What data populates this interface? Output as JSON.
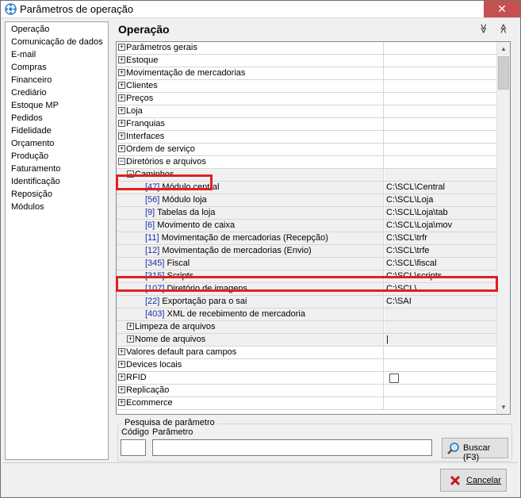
{
  "window": {
    "title": "Parâmetros de operação",
    "close_glyph": "✕"
  },
  "sidebar": {
    "items": [
      {
        "label": "Operação"
      },
      {
        "label": "Comunicação de dados"
      },
      {
        "label": "E-mail"
      },
      {
        "label": "Compras"
      },
      {
        "label": "Financeiro"
      },
      {
        "label": "Crediário"
      },
      {
        "label": "Estoque MP"
      },
      {
        "label": "Pedidos"
      },
      {
        "label": "Fidelidade"
      },
      {
        "label": "Orçamento"
      },
      {
        "label": "Produção"
      },
      {
        "label": "Faturamento"
      },
      {
        "label": "Identificação"
      },
      {
        "label": "Reposição"
      },
      {
        "label": "Módulos"
      }
    ]
  },
  "main": {
    "title": "Operação",
    "collapse_all_glyph": "≫",
    "expand_all_glyph": "≪"
  },
  "grid": {
    "rows": [
      {
        "expander": "+",
        "name": "Parâmetros gerais",
        "value": ""
      },
      {
        "expander": "+",
        "name": "Estoque",
        "value": ""
      },
      {
        "expander": "+",
        "name": "Movimentação de mercadorias",
        "value": ""
      },
      {
        "expander": "+",
        "name": "Clientes",
        "value": ""
      },
      {
        "expander": "+",
        "name": "Preços",
        "value": ""
      },
      {
        "expander": "+",
        "name": "Loja",
        "value": ""
      },
      {
        "expander": "+",
        "name": "Franquias",
        "value": ""
      },
      {
        "expander": "+",
        "name": "Interfaces",
        "value": ""
      },
      {
        "expander": "+",
        "name": "Ordem de serviço",
        "value": ""
      },
      {
        "expander": "−",
        "name": "Diretórios e arquivos",
        "value": ""
      },
      {
        "expander": "−",
        "name": "Caminhos",
        "value": ""
      },
      {
        "code": "[47]",
        "name": "Módulo central",
        "value": "C:\\SCL\\Central"
      },
      {
        "code": "[56]",
        "name": "Módulo loja",
        "value": "C:\\SCL\\Loja"
      },
      {
        "code": "[9]",
        "name": "Tabelas da loja",
        "value": "C:\\SCL\\Loja\\tab"
      },
      {
        "code": "[6]",
        "name": "Movimento de caixa",
        "value": "C:\\SCL\\Loja\\mov"
      },
      {
        "code": "[11]",
        "name": "Movimentação de mercadorias (Recepção)",
        "value": "C:\\SCL\\trfr"
      },
      {
        "code": "[12]",
        "name": "Movimentação de mercadorias (Envio)",
        "value": "C:\\SCL\\trfe"
      },
      {
        "code": "[345]",
        "name": "Fiscal",
        "value": "C:\\SCL\\fiscal"
      },
      {
        "code": "[315]",
        "name": "Scripts",
        "value": "C:\\SCL\\scripts"
      },
      {
        "code": "[107]",
        "name": "Diretório de imagens",
        "value": "C:\\SCL\\"
      },
      {
        "code": "[22]",
        "name": "Exportação para o sai",
        "value": "C:\\SAI"
      },
      {
        "code": "[403]",
        "name": "XML de recebimento de mercadoria",
        "value": ""
      },
      {
        "expander": "+",
        "name": "Limpeza de arquivos",
        "value": ""
      },
      {
        "expander": "+",
        "name": "Nome de arquivos",
        "value": "|"
      },
      {
        "expander": "+",
        "name": "Valores default para campos",
        "value": ""
      },
      {
        "expander": "+",
        "name": "Devices locais",
        "value": ""
      },
      {
        "expander": "+",
        "name": "RFID",
        "value": ""
      },
      {
        "expander": "+",
        "name": "Replicação",
        "value": ""
      },
      {
        "expander": "+",
        "name": "Ecommerce",
        "value": ""
      }
    ],
    "scroll_up_glyph": "▲",
    "scroll_down_glyph": "▼"
  },
  "search": {
    "legend": "Pesquisa de parâmetro",
    "code_label": "Código",
    "param_label": "Parâmetro",
    "code_value": "",
    "param_value": "",
    "button_label": "Buscar (F3)"
  },
  "footer": {
    "cancel_label": "Cancelar"
  },
  "colors": {
    "highlight": "#e02020",
    "code_text": "#1a2fa8",
    "close_button": "#c75050"
  }
}
